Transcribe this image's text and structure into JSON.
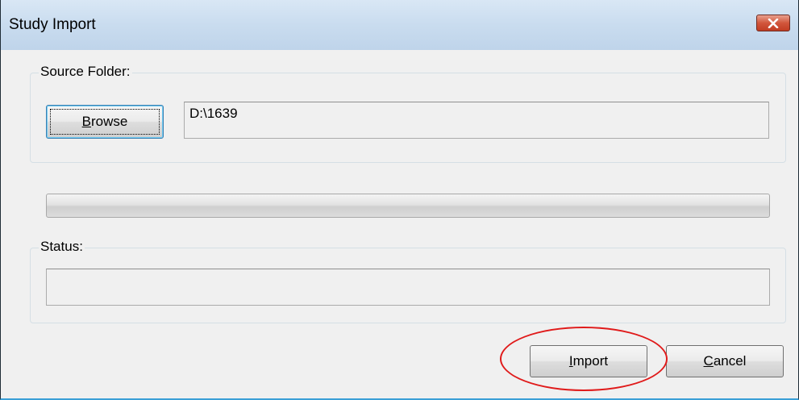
{
  "window": {
    "title": "Study Import",
    "close_icon": "close-icon"
  },
  "source_group": {
    "legend": "Source Folder:",
    "browse_button": {
      "mnemonic": "B",
      "rest": "rowse"
    },
    "path_value": "D:\\1639"
  },
  "progress": {
    "value": 0
  },
  "status_group": {
    "legend": "Status:",
    "status_value": ""
  },
  "buttons": {
    "import": {
      "mnemonic": "I",
      "rest": "mport"
    },
    "cancel": {
      "mnemonic": "C",
      "rest": "ancel"
    }
  },
  "annotation": {
    "color": "#e01a1a",
    "shape": "ellipse around Import button"
  },
  "colors": {
    "close_button": "#c13c22",
    "title_bar": "#c9dcef",
    "focus_border": "#3c7fb1"
  }
}
